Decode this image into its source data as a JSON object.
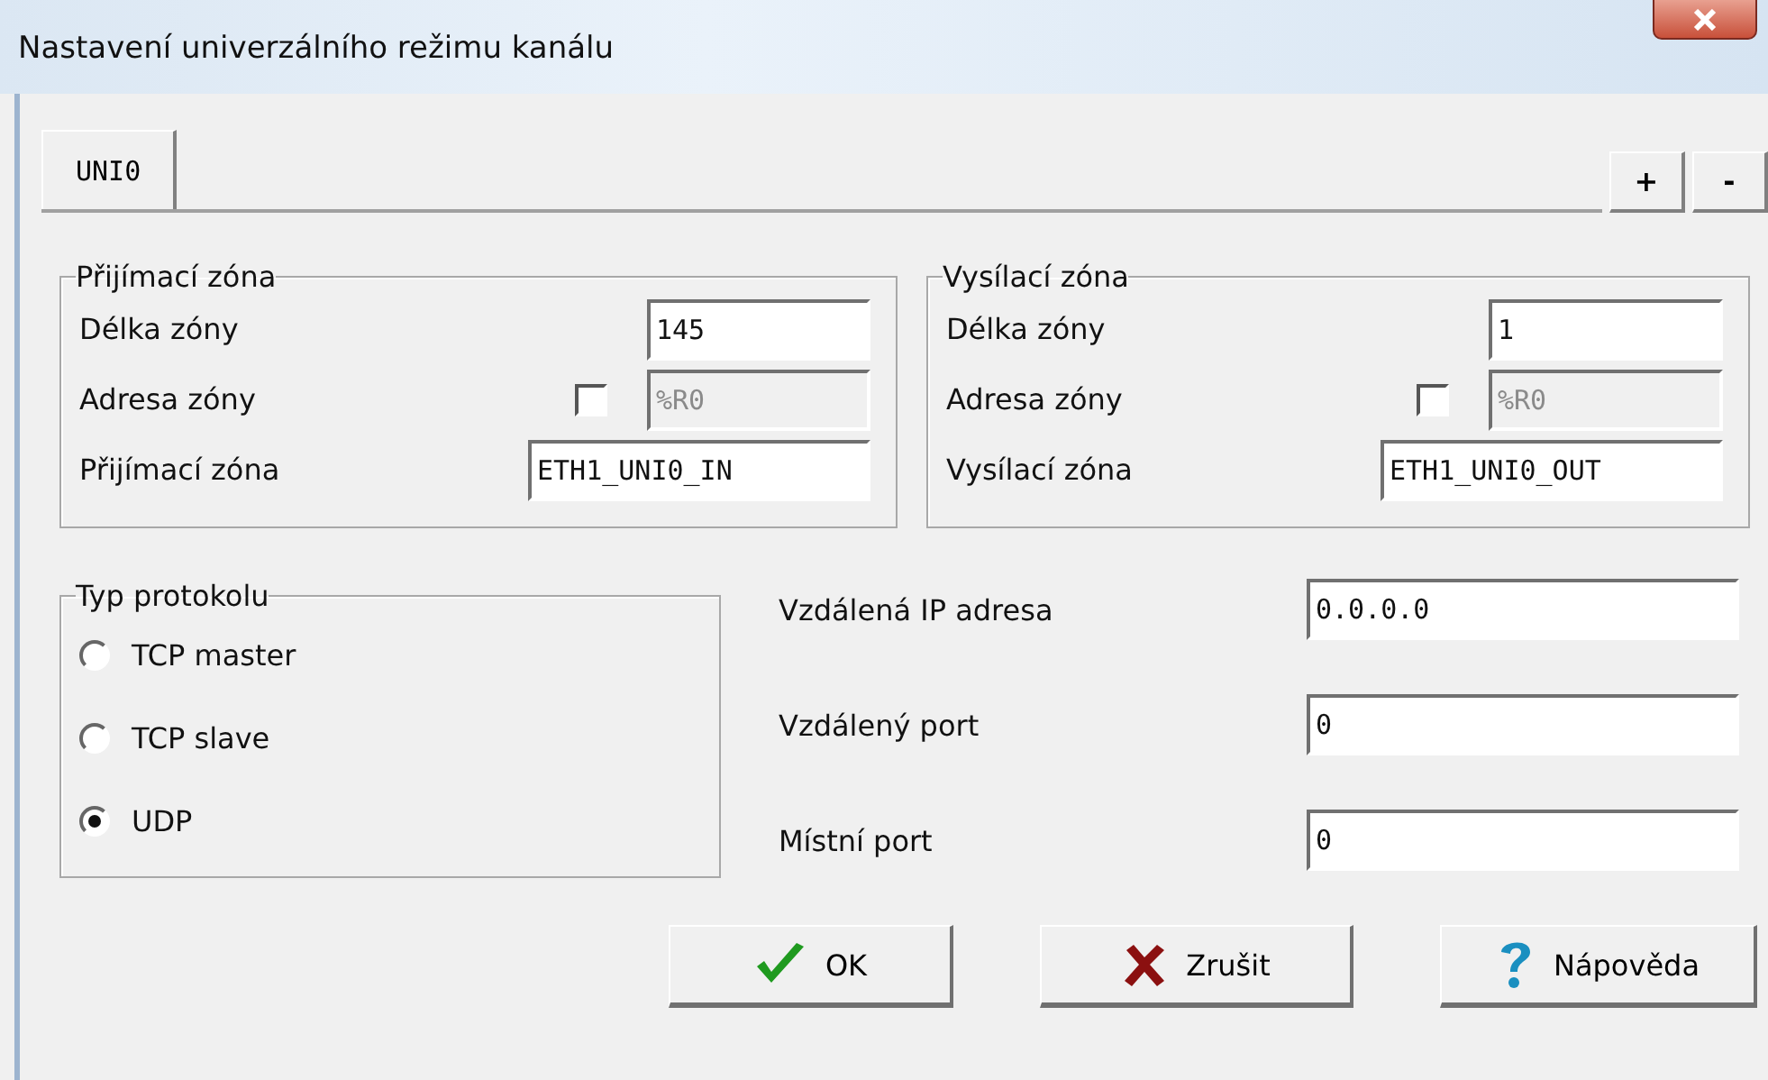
{
  "window": {
    "title": "Nastavení univerzálního režimu kanálu"
  },
  "tabs": [
    {
      "label": "UNI0",
      "selected": true
    }
  ],
  "tab_buttons": [
    "+",
    "-"
  ],
  "zones": [
    {
      "title": "Přijímací zóna",
      "length_label": "Délka zóny",
      "length": "145",
      "address_label": "Adresa zóny",
      "address_checked": false,
      "address": "%R0",
      "address_disabled": true,
      "name_label": "Přijímací zóna",
      "name": "ETH1_UNI0_IN"
    },
    {
      "title": "Vysílací zóna",
      "length_label": "Délka zóny",
      "length": "1",
      "address_label": "Adresa zóny",
      "address_checked": false,
      "address": "%R0",
      "address_disabled": true,
      "name_label": "Vysílací zóna",
      "name": "ETH1_UNI0_OUT"
    }
  ],
  "protocol": {
    "title": "Typ protokolu",
    "options": [
      {
        "label": "TCP master",
        "selected": false
      },
      {
        "label": "TCP slave",
        "selected": false
      },
      {
        "label": "UDP",
        "selected": true
      }
    ]
  },
  "network_fields": [
    {
      "label": "Vzdálená IP adresa",
      "value": "0.0.0.0"
    },
    {
      "label": "Vzdálený port",
      "value": "0"
    },
    {
      "label": "Místní port",
      "value": "0"
    }
  ],
  "buttons": [
    {
      "kind": "ok",
      "label": "OK"
    },
    {
      "kind": "cancel",
      "label": "Zrušit"
    },
    {
      "kind": "help",
      "label": "Nápověda"
    }
  ]
}
